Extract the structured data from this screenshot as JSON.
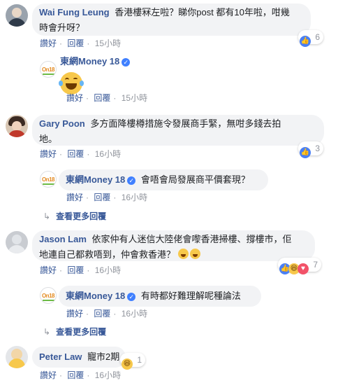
{
  "comments": [
    {
      "name": "Wai Fung Leung",
      "text_line1": "香港樓冧左啦？睇你post 都有10年啦，咁幾",
      "text_line2": "時會升呀？",
      "like": "讚好",
      "reply": "回覆",
      "time": "15小時",
      "reaction_count": "6",
      "replies": [
        {
          "name": "東網Money 18",
          "text": "",
          "like": "讚好",
          "reply": "回覆",
          "time": "15小時"
        }
      ]
    },
    {
      "name": "Gary Poon",
      "text_line1": "多方面降樓樽措施令發展商手緊，無咁多錢去拍",
      "text_line2": "地。",
      "like": "讚好",
      "reply": "回覆",
      "time": "16小時",
      "reaction_count": "3",
      "replies": [
        {
          "name": "東網Money 18",
          "text": "會唔會局發展商平價套現？",
          "like": "讚好",
          "reply": "回覆",
          "time": "16小時"
        }
      ],
      "more_replies": "查看更多回覆"
    },
    {
      "name": "Jason Lam",
      "text_line1": "依家仲有人迷信大陸佬會嚟香港掃樓、撐樓市，佢",
      "text_line2": "地連自己都救唔到，仲會救香港？",
      "like": "讚好",
      "reply": "回覆",
      "time": "16小時",
      "reaction_count": "7",
      "replies": [
        {
          "name": "東網Money 18",
          "text": "有時都好難理解呢種論法",
          "like": "讚好",
          "reply": "回覆",
          "time": "16小時"
        }
      ],
      "more_replies": "查看更多回覆"
    },
    {
      "name": "Peter Law",
      "text_line1": "寵市2期",
      "like": "讚好",
      "reply": "回覆",
      "time": "16小時",
      "reaction_count": "1"
    }
  ],
  "page_logo_text": "On18",
  "icons": {
    "like": "like-icon",
    "haha": "haha-icon",
    "love": "love-icon",
    "verified": "verified-badge-icon",
    "reply_arrow": "reply-arrow-icon"
  },
  "colors": {
    "link": "#385898",
    "muted": "#90949c",
    "bubble": "#f2f3f5",
    "like_blue": "#4a80f5"
  }
}
